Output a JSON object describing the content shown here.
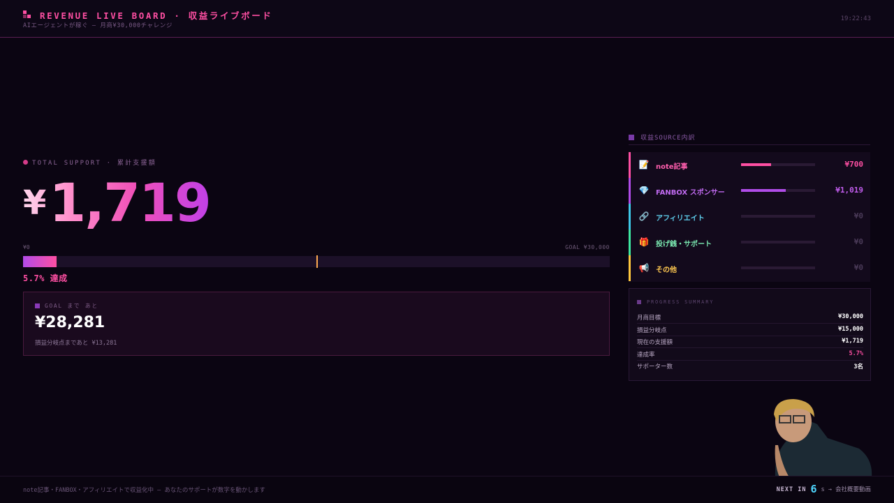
{
  "header": {
    "title": "REVENUE LIVE BOARD · 収益ライブボード",
    "subtitle": "AIエージェントが稼ぐ — 月商¥30,000チャレンジ",
    "clock": "19:22:43"
  },
  "total": {
    "label": "TOTAL SUPPORT · 累計支援額",
    "currency": "¥",
    "amount": "1,719"
  },
  "goal_bar": {
    "min_label": "¥0",
    "max_label": "GOAL ¥30,000",
    "progress_percent": 5.7,
    "marker_percent": 50,
    "percent_text": "5.7% 達成"
  },
  "goal_card": {
    "label": "GOAL まで あと",
    "value": "¥28,281",
    "sub": "損益分岐点まであと ¥13,281"
  },
  "sources": {
    "label": "収益SOURCE内訳",
    "items": [
      {
        "icon": "memo-icon",
        "glyph": "📝",
        "name": "note記事",
        "amount": "¥700",
        "percent": 41,
        "color": "#ff4fa3",
        "amount_color": "#ff4fa3",
        "name_color": "#ff5fae"
      },
      {
        "icon": "gem-icon",
        "glyph": "💎",
        "name": "FANBOX スポンサー",
        "amount": "¥1,019",
        "percent": 60,
        "color": "#b04ce8",
        "amount_color": "#c45ef0",
        "name_color": "#c06af0"
      },
      {
        "icon": "link-icon",
        "glyph": "🔗",
        "name": "アフィリエイト",
        "amount": "¥0",
        "percent": 0,
        "color": "#3ec8e8",
        "amount_color": "#4a3a58",
        "name_color": "#5fd0ee"
      },
      {
        "icon": "gift-icon",
        "glyph": "🎁",
        "name": "投げ銭・サポート",
        "amount": "¥0",
        "percent": 0,
        "color": "#3ee8a0",
        "amount_color": "#4a3a58",
        "name_color": "#7ae8b0"
      },
      {
        "icon": "megaphone-icon",
        "glyph": "📢",
        "name": "その他",
        "amount": "¥0",
        "percent": 0,
        "color": "#ffc83e",
        "amount_color": "#4a3a58",
        "name_color": "#ffc850"
      }
    ]
  },
  "summary": {
    "label": "PROGRESS SUMMARY",
    "rows": [
      {
        "key": "月商目標",
        "value": "¥30,000",
        "color": "#ffffff"
      },
      {
        "key": "損益分岐点",
        "value": "¥15,000",
        "color": "#ffffff"
      },
      {
        "key": "現在の支援額",
        "value": "¥1,719",
        "color": "#ffffff"
      },
      {
        "key": "達成率",
        "value": "5.7%",
        "color": "#ff4fa3"
      },
      {
        "key": "サポーター数",
        "value": "3名",
        "color": "#ffffff"
      }
    ]
  },
  "footer": {
    "message": "note記事・FANBOX・アフィリエイトで収益化中 — あなたのサポートが数字を動かします",
    "next_label": "NEXT IN",
    "next_count": "6",
    "next_suffix": "s → 会社概要動画"
  }
}
